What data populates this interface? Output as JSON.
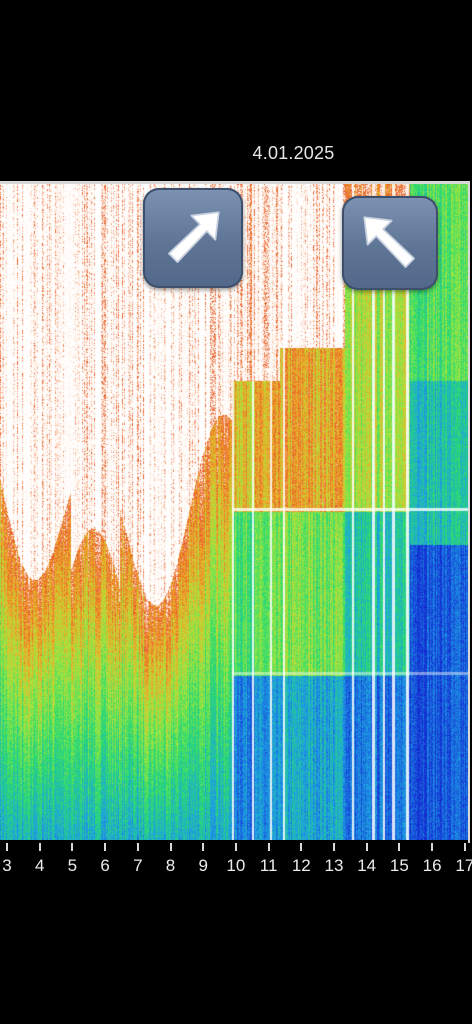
{
  "date": "4.01.2025",
  "x_axis": {
    "ticks": [
      "3",
      "4",
      "5",
      "6",
      "7",
      "8",
      "9",
      "10",
      "11",
      "12",
      "13",
      "14",
      "15",
      "16",
      "17"
    ]
  },
  "overlays": [
    {
      "icon": "up-right-arrow-icon"
    },
    {
      "icon": "up-left-arrow-icon"
    }
  ],
  "colors": {
    "background": "#000000",
    "arrow_badge": "#6a80a2",
    "arrow": "#ffffff",
    "spectrum_low": "#1430d8",
    "spectrum_mid": "#2ee06a",
    "spectrum_high": "#ff9a1e",
    "spectrum_peak": "#ffffff"
  }
}
